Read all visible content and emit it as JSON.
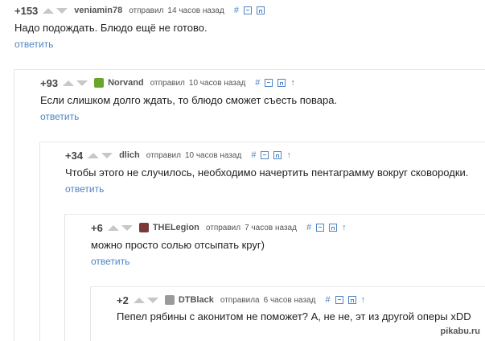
{
  "comments": [
    {
      "rating": "+153",
      "author": "veniamin78",
      "sent": "отправил",
      "time": "14 часов назад",
      "text": "Надо подождать. Блюдо ещё не готово.",
      "reply": "ответить",
      "avatar_color": ""
    },
    {
      "rating": "+93",
      "author": "Norvand",
      "sent": "отправил",
      "time": "10 часов назад",
      "text": "Если слишком долго ждать, то блюдо сможет съесть повара.",
      "reply": "ответить",
      "avatar_color": "#6aa52b"
    },
    {
      "rating": "+34",
      "author": "dlich",
      "sent": "отправил",
      "time": "10 часов назад",
      "text": "Чтобы этого не случилось, необходимо начертить пентаграмму вокруг сковородки.",
      "reply": "ответить",
      "avatar_color": ""
    },
    {
      "rating": "+6",
      "author": "THELegion",
      "sent": "отправил",
      "time": "7 часов назад",
      "text": "можно просто солью отсыпать круг)",
      "reply": "ответить",
      "avatar_color": "#7a3a3a"
    },
    {
      "rating": "+2",
      "author": "DTBlack",
      "sent": "отправила",
      "time": "6 часов назад",
      "text": "Пепел рябины с аконитом не поможет? А, не не, эт из другой оперы xDD",
      "reply": "",
      "avatar_color": "#9a9a9a"
    }
  ],
  "tools": {
    "link": "#",
    "up": "↑"
  },
  "watermark": "pikabu.ru",
  "colors": {
    "link": "#4f84c4",
    "vote": "#c7c7c7"
  }
}
